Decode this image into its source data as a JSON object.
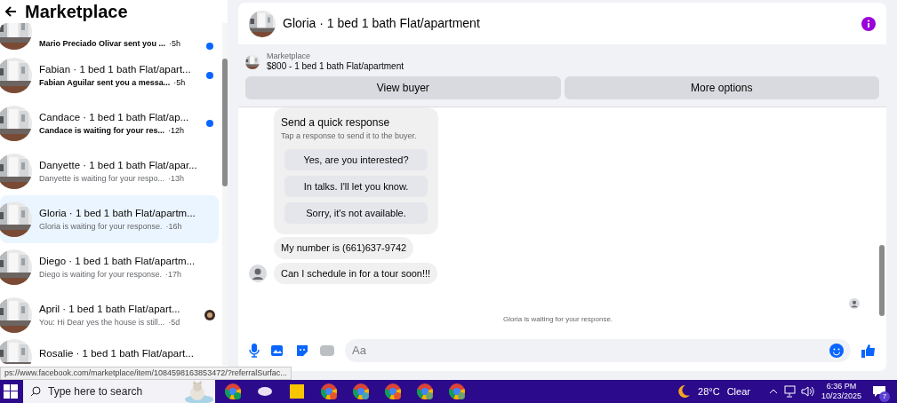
{
  "sidebar": {
    "title": "Marketplace",
    "conversations": [
      {
        "preview": "Mario Preciado Olivar sent you ...",
        "time": "·5h",
        "unread": true,
        "seen": false,
        "selected": false
      },
      {
        "title": "Fabian · 1 bed 1 bath Flat/apart...",
        "preview": "Fabian Aguilar sent you a messa...",
        "time": "·5h",
        "unread": true,
        "seen": false,
        "selected": false
      },
      {
        "title": "Candace · 1 bed 1 bath Flat/ap...",
        "preview": "Candace is waiting for your res...",
        "time": "·12h",
        "unread": true,
        "seen": false,
        "selected": false
      },
      {
        "title": "Danyette · 1 bed 1 bath Flat/apar...",
        "preview": "Danyette is waiting for your respo...",
        "time": "·13h",
        "unread": false,
        "seen": false,
        "selected": false
      },
      {
        "title": "Gloria · 1 bed 1 bath Flat/apartm...",
        "preview": "Gloria is waiting for your response.",
        "time": "·16h",
        "unread": false,
        "seen": false,
        "selected": true
      },
      {
        "title": "Diego · 1 bed 1 bath Flat/apartm...",
        "preview": "Diego is waiting for your response.",
        "time": "·17h",
        "unread": false,
        "seen": false,
        "selected": false
      },
      {
        "title": "April · 1 bed 1 bath Flat/apart...",
        "preview": "You: Hi Dear yes the house is still...",
        "time": "·5d",
        "unread": false,
        "seen": true,
        "selected": false
      },
      {
        "title": "Rosalie · 1 bed 1 bath Flat/apart...",
        "unread": false,
        "seen": false,
        "selected": false
      }
    ]
  },
  "status_url": "ps://www.facebook.com/marketplace/item/1084598163853472/?referralSurfac...",
  "chat": {
    "title": "Gloria · 1 bed 1 bath Flat/apartment",
    "listing": {
      "label": "Marketplace",
      "name": "$800 - 1 bed 1 bath Flat/apartment"
    },
    "actions": [
      "View buyer",
      "More options"
    ],
    "quick_response": {
      "title": "Send a quick response",
      "subtitle": "Tap a response to send it to the buyer.",
      "options": [
        "Yes, are you interested?",
        "In talks. I'll let you know.",
        "Sorry, it's not available."
      ]
    },
    "messages": [
      "My number is (661)637-9742",
      "Can I schedule in for a tour soon!!!"
    ],
    "status": "Gloria is waiting for your response.",
    "composer": {
      "placeholder": "Aa"
    }
  },
  "taskbar": {
    "search_placeholder": "Type here to search",
    "weather": {
      "temp": "28°C",
      "condition": "Clear"
    },
    "time": "6:36 PM",
    "date": "10/23/2025",
    "notifications": "7"
  }
}
